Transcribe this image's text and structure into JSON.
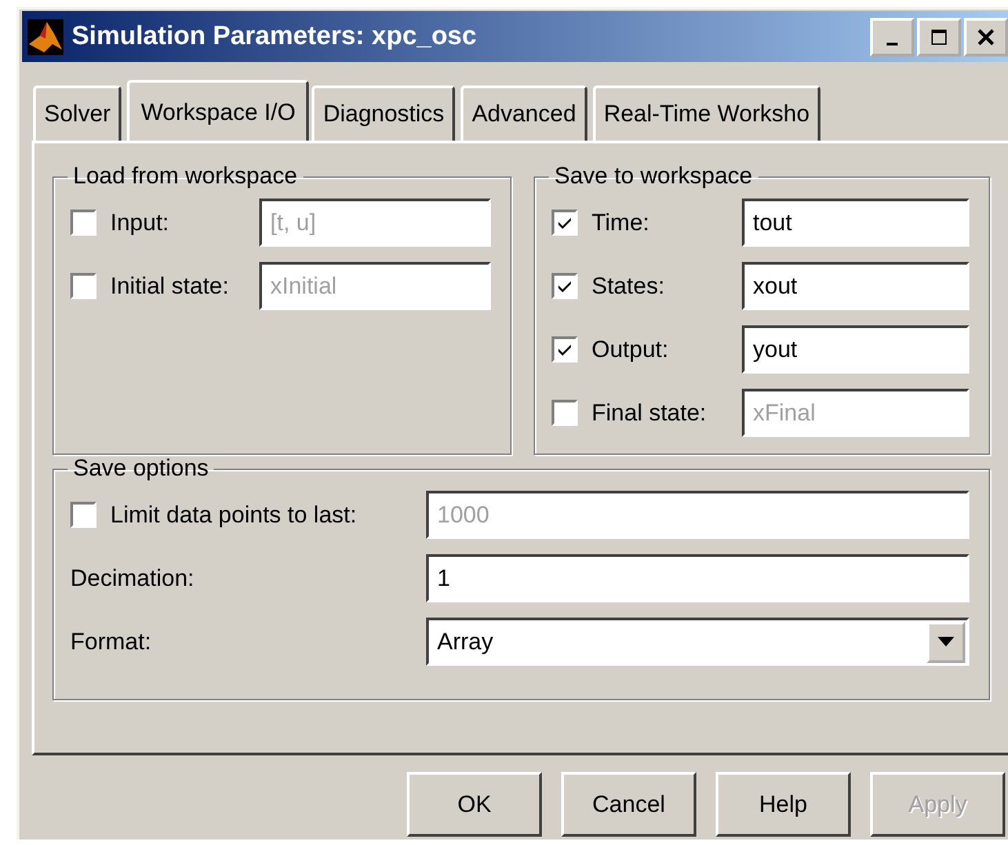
{
  "window": {
    "title": "Simulation Parameters: xpc_osc"
  },
  "tabs": [
    {
      "label": "Solver",
      "selected": false
    },
    {
      "label": "Workspace I/O",
      "selected": true
    },
    {
      "label": "Diagnostics",
      "selected": false
    },
    {
      "label": "Advanced",
      "selected": false
    },
    {
      "label": "Real-Time Worksho",
      "selected": false
    }
  ],
  "load_from_workspace": {
    "title": "Load from workspace",
    "rows": [
      {
        "label": "Input:",
        "checked": false,
        "value": "[t, u]",
        "disabled": true
      },
      {
        "label": "Initial state:",
        "checked": false,
        "value": "xInitial",
        "disabled": true
      }
    ]
  },
  "save_to_workspace": {
    "title": "Save to workspace",
    "rows": [
      {
        "label": "Time:",
        "checked": true,
        "value": "tout",
        "disabled": false
      },
      {
        "label": "States:",
        "checked": true,
        "value": "xout",
        "disabled": false
      },
      {
        "label": "Output:",
        "checked": true,
        "value": "yout",
        "disabled": false
      },
      {
        "label": "Final state:",
        "checked": false,
        "value": "xFinal",
        "disabled": true
      }
    ]
  },
  "save_options": {
    "title": "Save options",
    "rows": [
      {
        "kind": "checkbox",
        "label": "Limit data points to last:",
        "checked": false,
        "value": "1000",
        "disabled": true
      },
      {
        "kind": "text",
        "label": "Decimation:",
        "value": "1"
      },
      {
        "kind": "dropdown",
        "label": "Format:",
        "value": "Array"
      }
    ]
  },
  "buttons": [
    {
      "label": "OK",
      "disabled": false
    },
    {
      "label": "Cancel",
      "disabled": false
    },
    {
      "label": "Help",
      "disabled": false
    },
    {
      "label": "Apply",
      "disabled": true
    }
  ]
}
